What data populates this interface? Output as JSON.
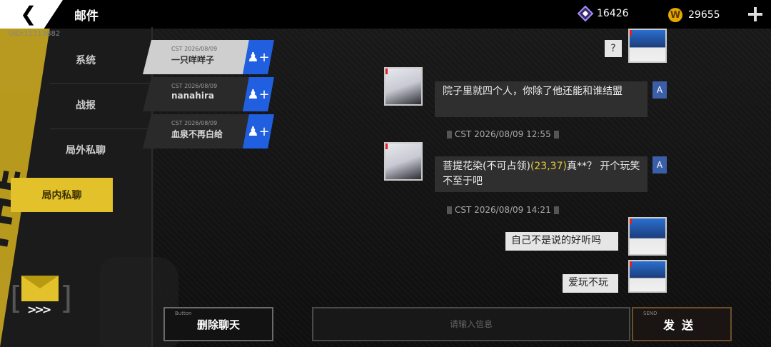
{
  "header": {
    "back_icon": "arrow-left-icon",
    "title": "邮件",
    "uid": "UID:11113882",
    "gems": "16426",
    "coins": "29655",
    "coin_symbol": "W"
  },
  "sidebar": {
    "decoration_text": "THE WAR",
    "items": [
      {
        "label": "系统"
      },
      {
        "label": "战报"
      },
      {
        "label": "局外私聊"
      },
      {
        "label": "局内私聊"
      }
    ]
  },
  "contacts": [
    {
      "time": "CST 2026/08/09",
      "name": "一只咩咩子"
    },
    {
      "time": "CST 2026/08/09",
      "name": "nanahira"
    },
    {
      "time": "CST 2026/08/09",
      "name": "血泉不再白给"
    }
  ],
  "chat": {
    "q_label": "?",
    "messages": [
      {
        "text": "院子里就四个人，你除了他还能和谁结盟"
      },
      {
        "pre": "菩提花染(不可占领)",
        "coord": "(23,37)",
        "post": "真**？ 开个玩笑不至于吧"
      },
      {
        "text": "自己不是说的好听吗"
      },
      {
        "text": "爱玩不玩"
      }
    ],
    "timestamps": [
      "CST 2026/08/09 12:55",
      "CST 2026/08/09 14:21"
    ],
    "translate_label": "A"
  },
  "footer": {
    "delete_small": "Button",
    "delete_label": "删除聊天",
    "input_placeholder": "请输入信息",
    "send_small": "SEND",
    "send_label": "发送"
  },
  "colors": {
    "accent_yellow": "#e2c12a",
    "blue": "#1f5fe0",
    "highlight": "#e7c83a"
  }
}
